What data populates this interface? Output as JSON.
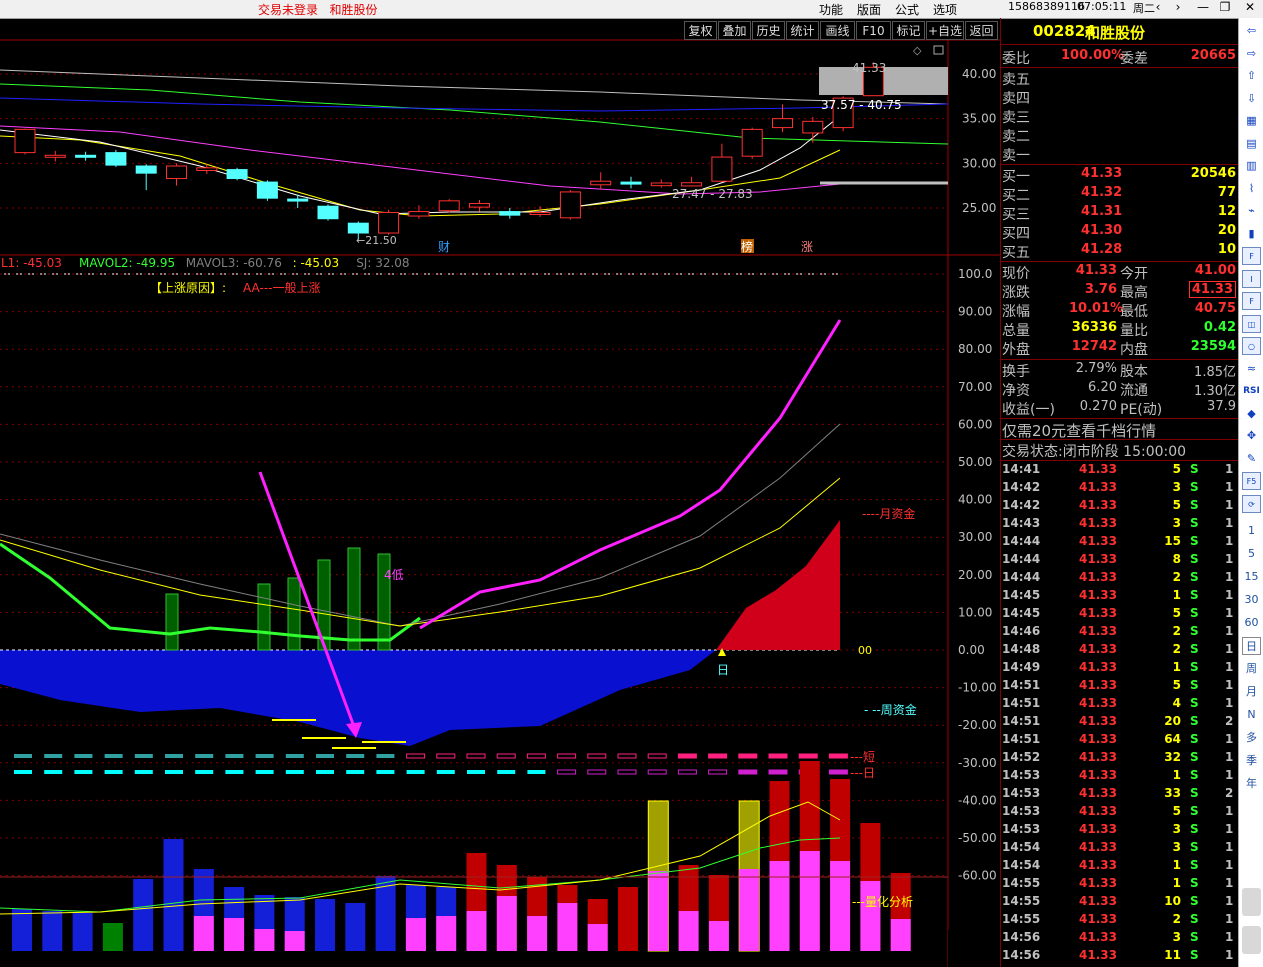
{
  "topbar": {
    "login_notice": "交易未登录",
    "stock_name": "和胜股份",
    "menus": [
      "功能",
      "版面",
      "公式",
      "选项"
    ],
    "phone": "15868389116",
    "time": "07:05:11",
    "weekday": "周二",
    "win_icons": [
      "back-arrow-icon",
      "forward-arrow-icon",
      "minimize-icon",
      "restore-icon",
      "close-icon"
    ],
    "win_glyphs": [
      "‹",
      "›",
      "—",
      "❐",
      "✕"
    ]
  },
  "toolbar": {
    "buttons": [
      "复权",
      "叠加",
      "历史",
      "统计",
      "画线",
      "F10",
      "标记",
      "+自选",
      "返回"
    ]
  },
  "kline": {
    "price_axis": [
      "40.00",
      "35.00",
      "30.00",
      "25.00"
    ],
    "labels": {
      "high_mark": "41.33",
      "range_top": "37.57 - 40.75",
      "range_mid": "27.47 - 27.83",
      "low_mark": "21.50",
      "tag_cai": "财",
      "tag_bang": "榜",
      "tag_zhang": "涨"
    },
    "candles": [
      {
        "o": 31.2,
        "c": 33.8,
        "h": 33.9,
        "l": 31.0
      },
      {
        "o": 30.8,
        "c": 30.9,
        "h": 31.4,
        "l": 30.2
      },
      {
        "o": 30.9,
        "c": 30.7,
        "h": 31.3,
        "l": 30.3
      },
      {
        "o": 31.2,
        "c": 29.8,
        "h": 31.5,
        "l": 29.6
      },
      {
        "o": 29.7,
        "c": 28.9,
        "h": 29.9,
        "l": 27.0
      },
      {
        "o": 28.3,
        "c": 29.7,
        "h": 30.0,
        "l": 27.5
      },
      {
        "o": 29.2,
        "c": 29.5,
        "h": 29.9,
        "l": 28.8
      },
      {
        "o": 29.3,
        "c": 28.3,
        "h": 29.5,
        "l": 28.1
      },
      {
        "o": 27.9,
        "c": 26.1,
        "h": 28.1,
        "l": 25.8
      },
      {
        "o": 26.0,
        "c": 25.9,
        "h": 26.5,
        "l": 25.0
      },
      {
        "o": 25.2,
        "c": 23.8,
        "h": 25.4,
        "l": 23.6
      },
      {
        "o": 23.3,
        "c": 22.2,
        "h": 23.5,
        "l": 21.5
      },
      {
        "o": 22.2,
        "c": 24.5,
        "h": 24.8,
        "l": 22.0
      },
      {
        "o": 24.1,
        "c": 24.6,
        "h": 25.3,
        "l": 23.8
      },
      {
        "o": 24.7,
        "c": 25.8,
        "h": 26.0,
        "l": 24.5
      },
      {
        "o": 25.1,
        "c": 25.5,
        "h": 25.9,
        "l": 24.6
      },
      {
        "o": 24.6,
        "c": 24.2,
        "h": 25.0,
        "l": 23.8
      },
      {
        "o": 24.4,
        "c": 24.5,
        "h": 25.2,
        "l": 24.0
      },
      {
        "o": 23.9,
        "c": 26.8,
        "h": 27.0,
        "l": 23.7
      },
      {
        "o": 27.6,
        "c": 28.0,
        "h": 29.0,
        "l": 27.1
      },
      {
        "o": 27.9,
        "c": 27.7,
        "h": 28.5,
        "l": 27.2
      },
      {
        "o": 27.5,
        "c": 27.8,
        "h": 28.2,
        "l": 27.3
      },
      {
        "o": 27.47,
        "c": 27.83,
        "h": 28.5,
        "l": 27.4
      },
      {
        "o": 28.0,
        "c": 30.7,
        "h": 32.2,
        "l": 27.9
      },
      {
        "o": 30.8,
        "c": 33.8,
        "h": 34.0,
        "l": 30.5
      },
      {
        "o": 34.0,
        "c": 35.0,
        "h": 36.6,
        "l": 33.5
      },
      {
        "o": 33.4,
        "c": 34.7,
        "h": 35.2,
        "l": 32.3
      },
      {
        "o": 34.0,
        "c": 37.3,
        "h": 37.5,
        "l": 33.6
      },
      {
        "o": 37.57,
        "c": 40.75,
        "h": 41.33,
        "l": 37.57
      }
    ]
  },
  "indicator": {
    "header": [
      {
        "text": "L1: -45.03",
        "color": "#ff3030"
      },
      {
        "text": "MAVOL2: -49.95",
        "color": "#30ff30"
      },
      {
        "text": "MAVOL3: -60.76",
        "color": "#808080"
      },
      {
        "text": ": -45.03",
        "color": "#ffff00"
      },
      {
        "text": "SJ: 32.08",
        "color": "#808080"
      }
    ],
    "reason_label": "【上涨原因】:",
    "reason_value": "AA---一般上涨",
    "axis": [
      "100.0",
      "90.00",
      "80.00",
      "70.00",
      "60.00",
      "50.00",
      "40.00",
      "30.00",
      "20.00",
      "10.00",
      "0.00",
      "-10.00",
      "-20.00",
      "-30.00",
      "-40.00",
      "-50.00",
      "-60.00"
    ],
    "label_month_fund": "----月资金",
    "label_week_fund": "- --周资金",
    "label_short": "---短",
    "label_day": "---日",
    "label_quant": "---量化分析",
    "label_low4": "4低",
    "label_ri": "日",
    "label_00": "00"
  },
  "volume": {
    "bars": [
      {
        "v": 42,
        "k": "b",
        "p": 0
      },
      {
        "v": 40,
        "k": "b",
        "p": 0
      },
      {
        "v": 38,
        "k": "b",
        "p": 0
      },
      {
        "v": 28,
        "k": "g",
        "p": 0
      },
      {
        "v": 72,
        "k": "b",
        "p": 0
      },
      {
        "v": 112,
        "k": "b",
        "p": 0
      },
      {
        "v": 82,
        "k": "b",
        "p": 35
      },
      {
        "v": 64,
        "k": "b",
        "p": 33
      },
      {
        "v": 56,
        "k": "b",
        "p": 22
      },
      {
        "v": 54,
        "k": "b",
        "p": 20
      },
      {
        "v": 52,
        "k": "b",
        "p": 0
      },
      {
        "v": 48,
        "k": "b",
        "p": 0
      },
      {
        "v": 75,
        "k": "b",
        "p": 0
      },
      {
        "v": 66,
        "k": "b",
        "p": 33
      },
      {
        "v": 64,
        "k": "b",
        "p": 35
      },
      {
        "v": 98,
        "k": "r",
        "p": 40
      },
      {
        "v": 86,
        "k": "r",
        "p": 55
      },
      {
        "v": 74,
        "k": "r",
        "p": 35
      },
      {
        "v": 66,
        "k": "r",
        "p": 48
      },
      {
        "v": 52,
        "k": "r",
        "p": 27
      },
      {
        "v": 64,
        "k": "r",
        "p": 0
      },
      {
        "v": 150,
        "k": "y",
        "p": 80
      },
      {
        "v": 86,
        "k": "r",
        "p": 40
      },
      {
        "v": 76,
        "k": "r",
        "p": 30
      },
      {
        "v": 150,
        "k": "y",
        "p": 82
      },
      {
        "v": 170,
        "k": "r",
        "p": 90
      },
      {
        "v": 190,
        "k": "r",
        "p": 100
      },
      {
        "v": 172,
        "k": "r",
        "p": 90
      },
      {
        "v": 128,
        "k": "r",
        "p": 70
      },
      {
        "v": 78,
        "k": "r",
        "p": 32
      }
    ]
  },
  "panel": {
    "code": "002824",
    "name": "和胜股份",
    "weibi_label": "委比",
    "weibi_value": "100.00%",
    "weicha_label": "委差",
    "weicha_value": "20665",
    "sells": [
      {
        "label": "卖五",
        "price": "",
        "vol": ""
      },
      {
        "label": "卖四",
        "price": "",
        "vol": ""
      },
      {
        "label": "卖三",
        "price": "",
        "vol": ""
      },
      {
        "label": "卖二",
        "price": "",
        "vol": ""
      },
      {
        "label": "卖一",
        "price": "",
        "vol": ""
      }
    ],
    "buys": [
      {
        "label": "买一",
        "price": "41.33",
        "vol": "20546"
      },
      {
        "label": "买二",
        "price": "41.32",
        "vol": "77"
      },
      {
        "label": "买三",
        "price": "41.31",
        "vol": "12"
      },
      {
        "label": "买四",
        "price": "41.30",
        "vol": "20"
      },
      {
        "label": "买五",
        "price": "41.28",
        "vol": "10"
      }
    ],
    "stats": [
      {
        "l1": "现价",
        "v1": "41.33",
        "c1": "#ff3030",
        "l2": "今开",
        "v2": "41.00",
        "c2": "#ff3030"
      },
      {
        "l1": "涨跌",
        "v1": "3.76",
        "c1": "#ff3030",
        "l2": "最高",
        "v2": "41.33",
        "c2": "#ff3030"
      },
      {
        "l1": "涨幅",
        "v1": "10.01%",
        "c1": "#ff3030",
        "l2": "最低",
        "v2": "40.75",
        "c2": "#ff3030"
      },
      {
        "l1": "总量",
        "v1": "36336",
        "c1": "#ffff00",
        "l2": "量比",
        "v2": "0.42",
        "c2": "#30ff30"
      },
      {
        "l1": "外盘",
        "v1": "12742",
        "c1": "#ff3030",
        "l2": "内盘",
        "v2": "23594",
        "c2": "#30ff30"
      }
    ],
    "stats2": [
      {
        "l1": "换手",
        "v1": "2.79%",
        "l2": "股本",
        "v2": "1.85亿"
      },
      {
        "l1": "净资",
        "v1": "6.20",
        "l2": "流通",
        "v2": "1.30亿"
      },
      {
        "l1": "收益(一)",
        "v1": "0.270",
        "l2": "PE(动)",
        "v2": "37.9"
      }
    ],
    "promo": "仅需20元查看千档行情",
    "status": "交易状态:闭市阶段 15:00:00",
    "ticks": [
      {
        "t": "14:41",
        "p": "41.33",
        "v": "5",
        "s": "S",
        "n": "1"
      },
      {
        "t": "14:42",
        "p": "41.33",
        "v": "3",
        "s": "S",
        "n": "1"
      },
      {
        "t": "14:42",
        "p": "41.33",
        "v": "5",
        "s": "S",
        "n": "1"
      },
      {
        "t": "14:43",
        "p": "41.33",
        "v": "3",
        "s": "S",
        "n": "1"
      },
      {
        "t": "14:44",
        "p": "41.33",
        "v": "15",
        "s": "S",
        "n": "1"
      },
      {
        "t": "14:44",
        "p": "41.33",
        "v": "8",
        "s": "S",
        "n": "1"
      },
      {
        "t": "14:44",
        "p": "41.33",
        "v": "2",
        "s": "S",
        "n": "1"
      },
      {
        "t": "14:45",
        "p": "41.33",
        "v": "1",
        "s": "S",
        "n": "1"
      },
      {
        "t": "14:45",
        "p": "41.33",
        "v": "5",
        "s": "S",
        "n": "1"
      },
      {
        "t": "14:46",
        "p": "41.33",
        "v": "2",
        "s": "S",
        "n": "1"
      },
      {
        "t": "14:48",
        "p": "41.33",
        "v": "2",
        "s": "S",
        "n": "1"
      },
      {
        "t": "14:49",
        "p": "41.33",
        "v": "1",
        "s": "S",
        "n": "1"
      },
      {
        "t": "14:51",
        "p": "41.33",
        "v": "5",
        "s": "S",
        "n": "1"
      },
      {
        "t": "14:51",
        "p": "41.33",
        "v": "4",
        "s": "S",
        "n": "1"
      },
      {
        "t": "14:51",
        "p": "41.33",
        "v": "20",
        "s": "S",
        "n": "2"
      },
      {
        "t": "14:51",
        "p": "41.33",
        "v": "64",
        "s": "S",
        "n": "1"
      },
      {
        "t": "14:52",
        "p": "41.33",
        "v": "32",
        "s": "S",
        "n": "1"
      },
      {
        "t": "14:53",
        "p": "41.33",
        "v": "1",
        "s": "S",
        "n": "1"
      },
      {
        "t": "14:53",
        "p": "41.33",
        "v": "33",
        "s": "S",
        "n": "2"
      },
      {
        "t": "14:53",
        "p": "41.33",
        "v": "5",
        "s": "S",
        "n": "1"
      },
      {
        "t": "14:53",
        "p": "41.33",
        "v": "3",
        "s": "S",
        "n": "1"
      },
      {
        "t": "14:54",
        "p": "41.33",
        "v": "3",
        "s": "S",
        "n": "1"
      },
      {
        "t": "14:54",
        "p": "41.33",
        "v": "1",
        "s": "S",
        "n": "1"
      },
      {
        "t": "14:55",
        "p": "41.33",
        "v": "1",
        "s": "S",
        "n": "1"
      },
      {
        "t": "14:55",
        "p": "41.33",
        "v": "10",
        "s": "S",
        "n": "1"
      },
      {
        "t": "14:55",
        "p": "41.33",
        "v": "2",
        "s": "S",
        "n": "1"
      },
      {
        "t": "14:56",
        "p": "41.33",
        "v": "3",
        "s": "S",
        "n": "1"
      },
      {
        "t": "14:56",
        "p": "41.33",
        "v": "11",
        "s": "S",
        "n": "1"
      }
    ]
  },
  "sidebar": {
    "items": [
      {
        "icon": "arrow-left-icon",
        "glyph": "⇦",
        "kind": "plain"
      },
      {
        "icon": "arrow-right-icon",
        "glyph": "⇨",
        "kind": "plain"
      },
      {
        "icon": "arrow-up-icon",
        "glyph": "⇧",
        "kind": "plain"
      },
      {
        "icon": "arrow-down-icon",
        "glyph": "⇩",
        "kind": "plain"
      },
      {
        "icon": "chart-icon",
        "glyph": "▦",
        "kind": "plain"
      },
      {
        "icon": "grid-icon",
        "glyph": "▤",
        "kind": "plain"
      },
      {
        "icon": "kline-icon",
        "glyph": "▥",
        "kind": "plain"
      },
      {
        "icon": "line-chart-icon",
        "glyph": "⌇",
        "kind": "plain"
      },
      {
        "icon": "trend-icon",
        "glyph": "⌁",
        "kind": "plain"
      },
      {
        "icon": "bars-icon",
        "glyph": "▮",
        "kind": "plain"
      },
      {
        "icon": "fm-icon",
        "glyph": "F",
        "kind": "boxed"
      },
      {
        "icon": "tally-icon",
        "glyph": "I",
        "kind": "boxed"
      },
      {
        "icon": "f2-icon",
        "glyph": "F",
        "kind": "boxed"
      },
      {
        "icon": "box-icon",
        "glyph": "◫",
        "kind": "boxed"
      },
      {
        "icon": "circle-icon",
        "glyph": "○",
        "kind": "boxed"
      },
      {
        "icon": "wave-icon",
        "glyph": "≈",
        "kind": "plain"
      },
      {
        "icon": "rsi-icon",
        "glyph": "RSI",
        "kind": "plain"
      },
      {
        "icon": "diamond-icon",
        "glyph": "◆",
        "kind": "plain"
      },
      {
        "icon": "move-icon",
        "glyph": "✥",
        "kind": "plain"
      },
      {
        "icon": "pencil-icon",
        "glyph": "✎",
        "kind": "plain"
      },
      {
        "icon": "f5-icon",
        "glyph": "F5",
        "kind": "boxed"
      },
      {
        "icon": "refresh-icon",
        "glyph": "⟳",
        "kind": "boxed"
      }
    ],
    "periods": [
      "1",
      "5",
      "15",
      "30",
      "60",
      "日",
      "周",
      "月",
      "N",
      "多",
      "季",
      "年"
    ],
    "selected_period": "日",
    "scroll_icons": [
      "scroll-up-icon",
      "scroll-down-icon"
    ]
  },
  "colors": {
    "up": "#ff3030",
    "down": "#54ffff",
    "grid": "#800000",
    "axis_text": "#c0c0c0"
  }
}
